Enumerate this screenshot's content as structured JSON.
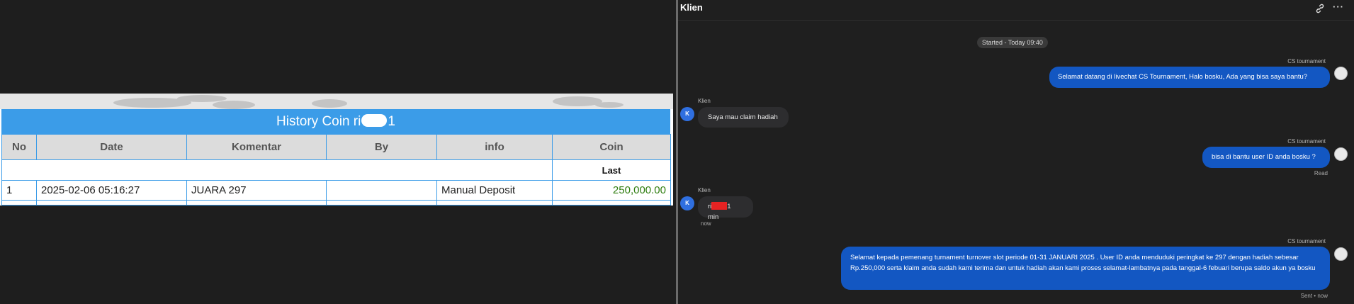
{
  "history": {
    "title_prefix": "History Coin ri",
    "title_suffix": "1",
    "columns": [
      "No",
      "Date",
      "Komentar",
      "By",
      "info",
      "Coin"
    ],
    "last_label": "Last",
    "rows": [
      {
        "no": "1",
        "date": "2025-02-06 05:16:27",
        "komentar": "JUARA 297",
        "by": "",
        "info": "Manual Deposit",
        "coin": "250,000.00"
      }
    ]
  },
  "chat": {
    "title": "Klien",
    "icons": {
      "link": "link-icon",
      "more": "more-horizontal-icon"
    },
    "more_glyph": "···",
    "started": "Started - Today 09:40",
    "messages": [
      {
        "sender": "CS tournament",
        "text": "Selamat datang di livechat CS Tournament, Halo bosku, Ada yang bisa saya bantu?"
      },
      {
        "sender": "Klien",
        "avatar": "K",
        "text": "Saya mau claim hadiah"
      },
      {
        "sender": "CS tournament",
        "text": "bisa di bantu user ID anda bosku ?",
        "status": "Read"
      },
      {
        "sender": "Klien",
        "avatar": "K",
        "text_prefix": "ri",
        "text_suffix": "1 min",
        "time": "now"
      },
      {
        "sender": "CS tournament",
        "text": "Selamat kepada pemenang turnament turnover slot periode 01-31 JANUARI 2025 . User ID anda menduduki peringkat ke 297 dengan hadiah sebesar Rp.250,000 serta klaim anda sudah kami terima dan untuk hadiah akan kami proses selamat-lambatnya pada tanggal-6 febuari berupa saldo akun ya bosku",
        "status": "Sent • now"
      }
    ]
  },
  "colors": {
    "table_header": "#3b9ce8",
    "coin_value": "#2e7d0f",
    "agent_bubble": "#1357c2",
    "client_bubble": "#2d2d2f",
    "background": "#1e1e1e"
  }
}
